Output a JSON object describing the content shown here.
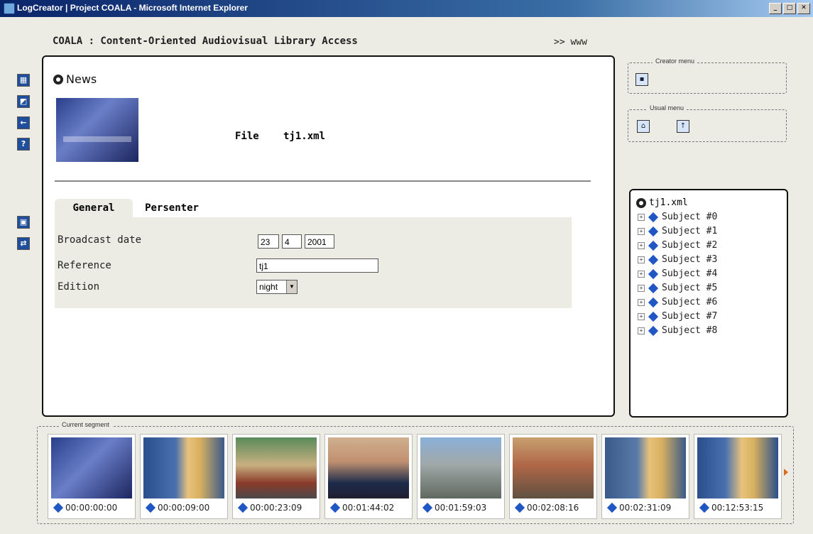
{
  "window": {
    "title": "LogCreator | Project COALA - Microsoft Internet Explorer",
    "buttons": [
      "_",
      "□",
      "✕"
    ]
  },
  "header": {
    "title": "COALA : Content-Oriented Audiovisual Library Access",
    "link": ">> www"
  },
  "main": {
    "section_title": "News",
    "file_label": "File",
    "file_value": "tj1.xml",
    "tabs": [
      "General",
      "Persenter"
    ],
    "form": {
      "broadcast_label": "Broadcast date",
      "day": "23",
      "month": "4",
      "year": "2001",
      "reference_label": "Reference",
      "reference_value": "tj1",
      "edition_label": "Edition",
      "edition_value": "night"
    }
  },
  "menus": {
    "creator": "Creator menu",
    "usual": "Usual menu"
  },
  "tree": {
    "root": "tj1.xml",
    "items": [
      "Subject #0",
      "Subject #1",
      "Subject #2",
      "Subject #3",
      "Subject #4",
      "Subject #5",
      "Subject #6",
      "Subject #7",
      "Subject #8"
    ]
  },
  "segment": {
    "legend": "Current segment",
    "timecodes": [
      "00:00:00:00",
      "00:00:09:00",
      "00:00:23:09",
      "00:01:44:02",
      "00:01:59:03",
      "00:02:08:16",
      "00:02:31:09",
      "00:12:53:15"
    ]
  },
  "colors": {
    "accent": "#1f56c4",
    "frame": "#ecece4"
  }
}
